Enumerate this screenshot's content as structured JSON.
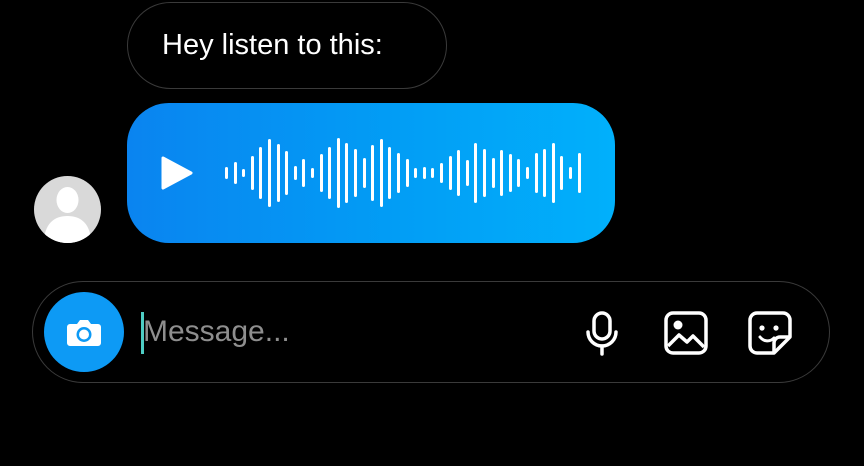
{
  "thread": {
    "text_message": "Hey listen to this:",
    "voice_message": {
      "waveform_levels": [
        0.12,
        0.22,
        0.08,
        0.35,
        0.55,
        0.7,
        0.6,
        0.45,
        0.15,
        0.3,
        0.1,
        0.4,
        0.55,
        0.72,
        0.62,
        0.5,
        0.32,
        0.58,
        0.7,
        0.55,
        0.42,
        0.3,
        0.1,
        0.12,
        0.1,
        0.2,
        0.35,
        0.48,
        0.28,
        0.62,
        0.5,
        0.32,
        0.48,
        0.4,
        0.3,
        0.12,
        0.42,
        0.5,
        0.62,
        0.35,
        0.12,
        0.42
      ],
      "colors": {
        "gradient_start": "#0a84f0",
        "gradient_end": "#01b0fb",
        "waveform": "#ffffff"
      }
    },
    "sender_avatar_icon": "default-user-avatar"
  },
  "composer": {
    "placeholder": "Message...",
    "value": "",
    "camera_icon": "camera-icon",
    "mic_icon": "microphone-icon",
    "gallery_icon": "image-icon",
    "sticker_icon": "sticker-icon",
    "camera_color": "#0d9af5",
    "caret_color": "#4ecdc4"
  },
  "theme": {
    "background": "#000000",
    "outline": "#3a3a3a"
  }
}
